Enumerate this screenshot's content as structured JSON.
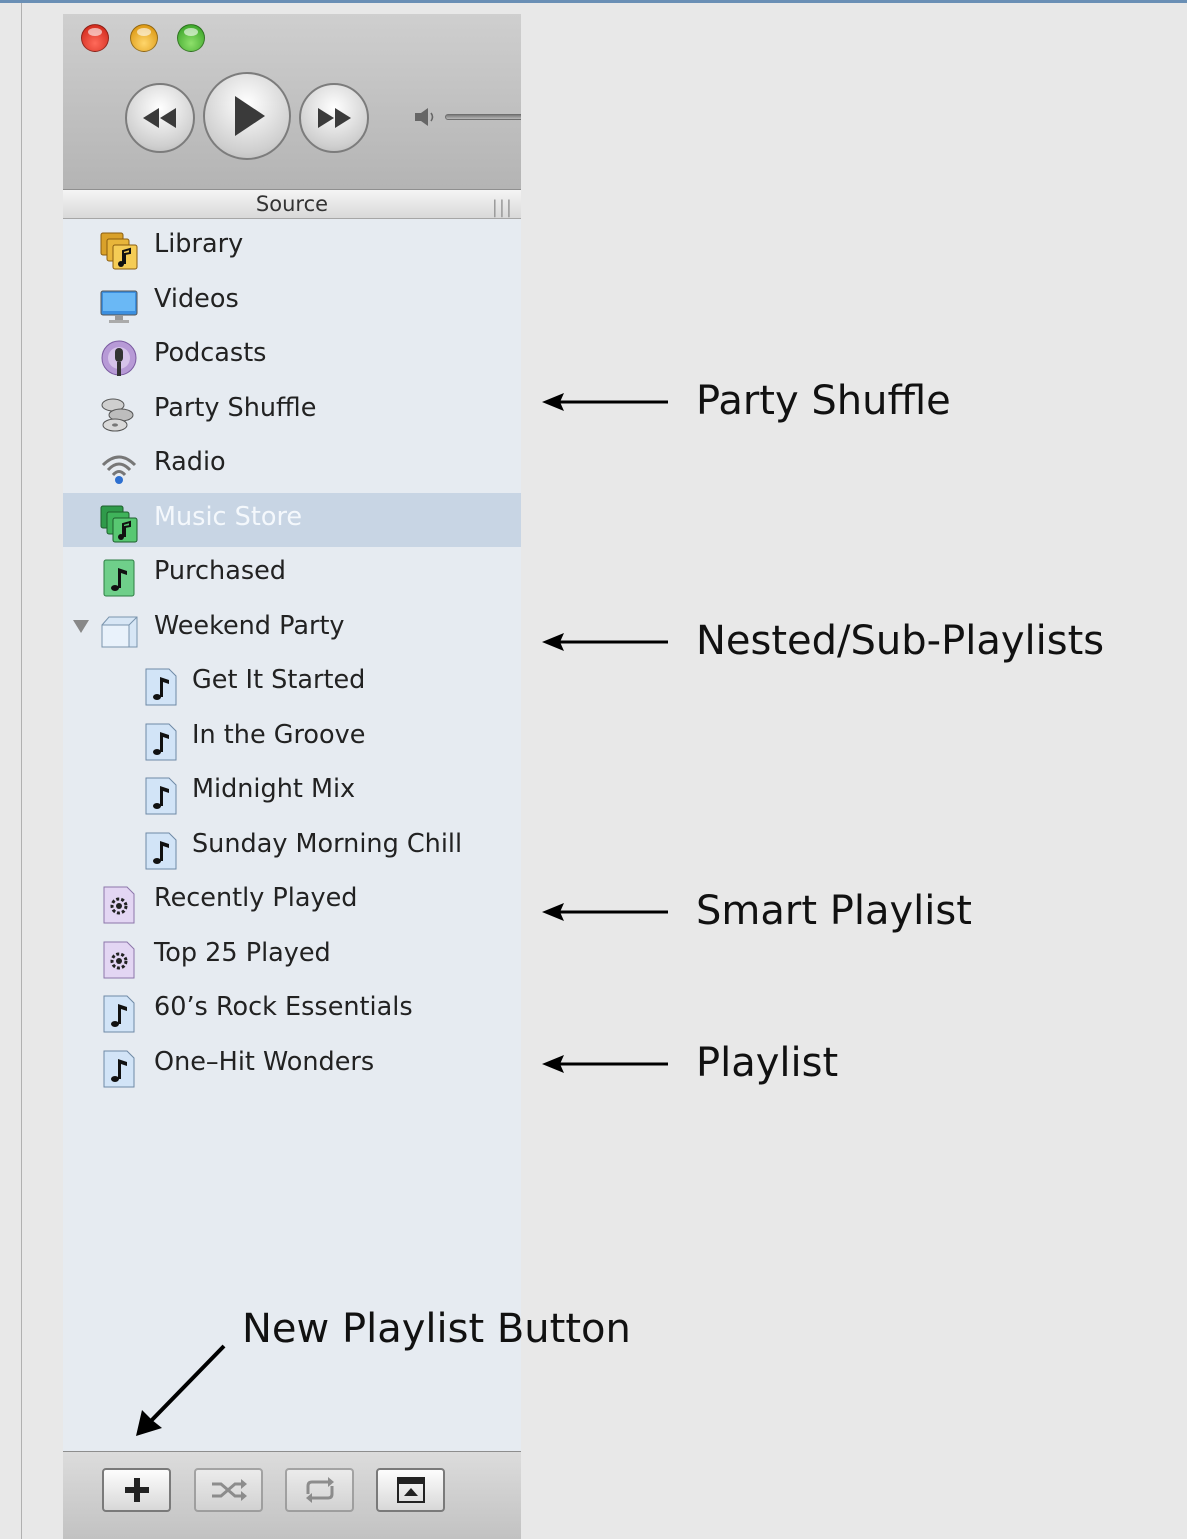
{
  "source": {
    "header_label": "Source",
    "items": [
      {
        "label": "Library",
        "icon": "library-icon"
      },
      {
        "label": "Videos",
        "icon": "videos-icon"
      },
      {
        "label": "Podcasts",
        "icon": "podcasts-icon"
      },
      {
        "label": "Party Shuffle",
        "icon": "party-shuffle-icon"
      },
      {
        "label": "Radio",
        "icon": "radio-icon"
      },
      {
        "label": "Music Store",
        "icon": "music-store-icon",
        "selected": true
      },
      {
        "label": "Purchased",
        "icon": "purchased-icon"
      },
      {
        "label": "Weekend Party",
        "icon": "folder-icon",
        "expanded": true
      },
      {
        "label": "Get It Started",
        "icon": "playlist-icon"
      },
      {
        "label": "In the Groove",
        "icon": "playlist-icon"
      },
      {
        "label": "Midnight Mix",
        "icon": "playlist-icon"
      },
      {
        "label": "Sunday Morning Chill",
        "icon": "playlist-icon"
      },
      {
        "label": "Recently Played",
        "icon": "smart-playlist-icon"
      },
      {
        "label": "Top 25 Played",
        "icon": "smart-playlist-icon"
      },
      {
        "label": "60’s Rock Essentials",
        "icon": "playlist-icon"
      },
      {
        "label": "One–Hit Wonders",
        "icon": "playlist-icon"
      }
    ]
  },
  "annotations": {
    "party_shuffle": "Party Shuffle",
    "nested": "Nested/Sub-Playlists",
    "smart_playlist": "Smart Playlist",
    "playlist": "Playlist",
    "new_playlist_button": "New Playlist Button"
  },
  "colors": {
    "selection": "#c8d5e4",
    "source_background": "#e6ebf1",
    "page_background": "#e8e8e8"
  }
}
